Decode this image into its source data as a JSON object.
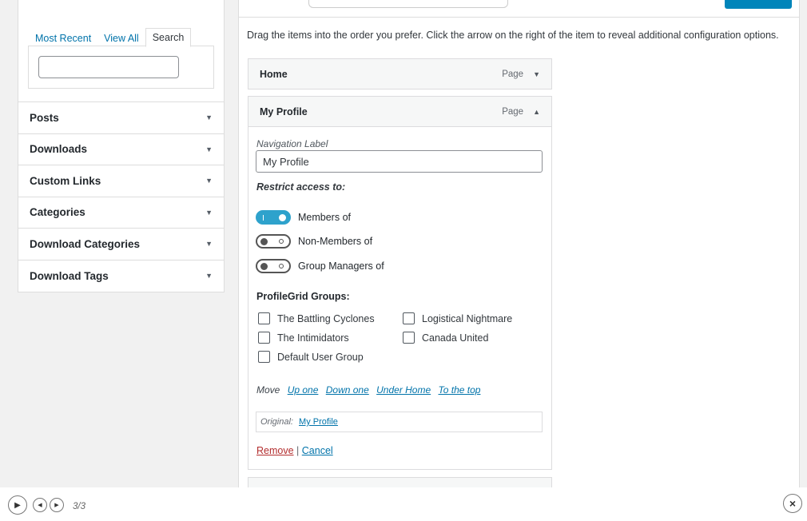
{
  "left": {
    "tabs": [
      "Most Recent",
      "View All",
      "Search"
    ],
    "active_tab": "Search",
    "search_value": "",
    "accordion": [
      "Posts",
      "Downloads",
      "Custom Links",
      "Categories",
      "Download Categories",
      "Download Tags"
    ]
  },
  "main": {
    "instructions": "Drag the items into the order you prefer. Click the arrow on the right of the item to reveal additional configuration options.",
    "items": [
      {
        "title": "Home",
        "type": "Page"
      },
      {
        "title": "My Profile",
        "type": "Page"
      }
    ],
    "edit": {
      "nav_label_caption": "Navigation Label",
      "nav_label_value": "My Profile",
      "restrict_title": "Restrict access to:",
      "toggles": [
        {
          "label": "Members of",
          "on": true
        },
        {
          "label": "Non-Members of",
          "on": false
        },
        {
          "label": "Group Managers of",
          "on": false
        }
      ],
      "groups_title": "ProfileGrid Groups:",
      "groups": [
        "The Battling Cyclones",
        "Logistical Nightmare",
        "The Intimidators",
        "Canada United",
        "Default User Group"
      ],
      "move_label": "Move",
      "move_links": [
        "Up one",
        "Down one",
        "Under Home",
        "To the top"
      ],
      "original_label": "Original:",
      "original_link": "My Profile",
      "remove": "Remove",
      "separator": "|",
      "cancel": "Cancel"
    }
  },
  "player": {
    "counter": "3/3"
  },
  "colors": {
    "accent": "#0085ba",
    "link": "#0073aa",
    "toggle_on": "#2ea2cc",
    "danger": "#b32d2e"
  }
}
